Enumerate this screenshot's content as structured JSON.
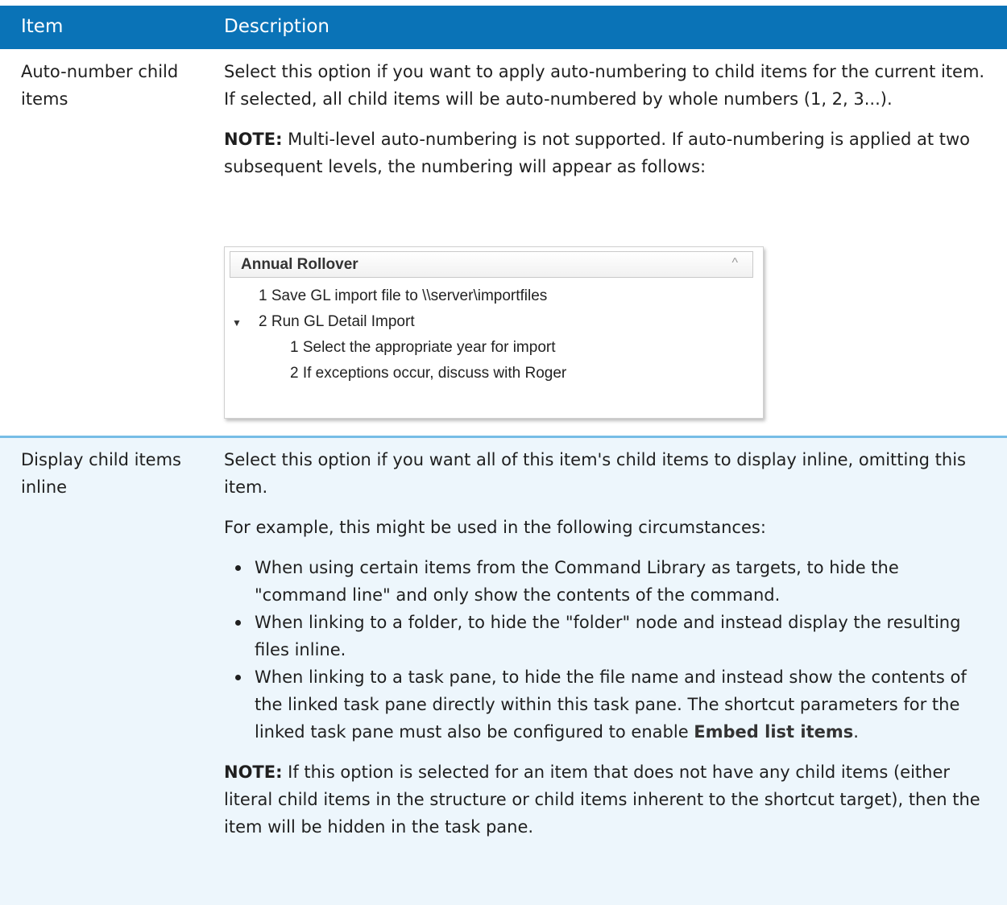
{
  "header": {
    "col_item": "Item",
    "col_description": "Description"
  },
  "rows": [
    {
      "item": "Auto-number child items",
      "description": "Select this option if you want to apply auto-numbering to child items for the current item. If selected, all child items will be auto-numbered by whole numbers (1, 2, 3...).",
      "note_label": "NOTE:",
      "note_text": " Multi-level auto-numbering is not supported. If auto-numbering is applied at two subsequent levels, the numbering will appear as follows:",
      "screenshot": {
        "title": "Annual Rollover",
        "collapse_icon": "chevron-up-icon",
        "lines": [
          "1 Save GL import file to \\\\server\\importfiles",
          "2 Run GL Detail Import",
          "1 Select the appropriate year for import",
          "2 If exceptions occur, discuss with Roger"
        ]
      }
    },
    {
      "item": "Display child items inline",
      "description": "Select this option if you want all of this item's child items to display inline, omitting this item.",
      "example_intro": "For example, this might be used in the following circumstances:",
      "bullets": [
        "When using certain items from the Command Library as targets, to hide the \"command line\" and only show the contents of the command.",
        "When linking to a folder, to hide the \"folder\" node and instead display the resulting files inline.",
        "When linking to a task pane, to hide the file name and instead show the contents of the linked task pane directly within this task pane. The shortcut parameters for the linked task pane must also be configured to enable "
      ],
      "bullet3_bold": "Embed list items",
      "bullet3_end": ".",
      "note_label": "NOTE:",
      "note_text": " If this option is selected for an item that does not have any child items (either literal child items in the structure or child items inherent to the shortcut target), then the item will be hidden in the task pane."
    }
  ]
}
